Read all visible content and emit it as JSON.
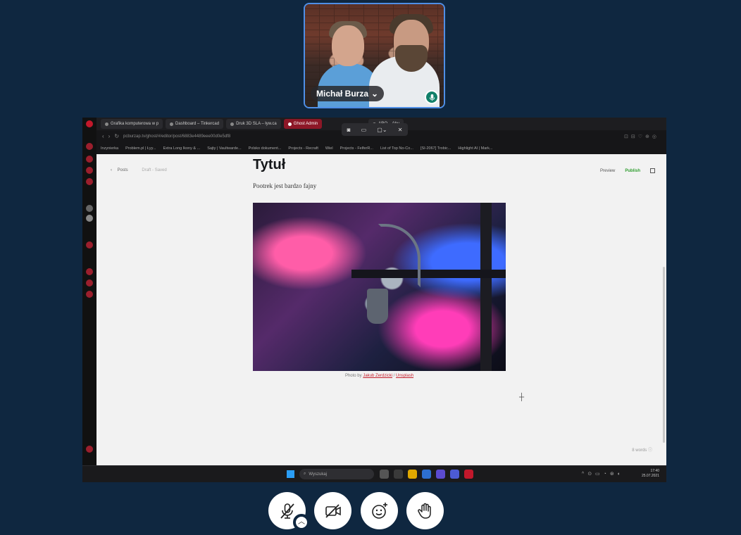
{
  "participant": {
    "name": "Michał Burza",
    "speaking": true
  },
  "browser": {
    "tabs": [
      {
        "label": "Grafika komputerowa w p",
        "active": false
      },
      {
        "label": "Dashboard – Tinkercad",
        "active": false
      },
      {
        "label": "Druk 3D SLA – ływ.ca",
        "active": false
      },
      {
        "label": "Ghost Admin",
        "active": true
      },
      {
        "label": "ARO – Ahu",
        "active": false
      }
    ],
    "url": "pcburzap.tv/ghost/#/editor/post/6883e4489eee00d0e5df8",
    "bookmarks": [
      "Inzynierka",
      "Problem.pl | Łyy...",
      "Extra Long Ikony & ...",
      "Sajty | Vaultwarde...",
      "Polsko dokument...",
      "Projects - Recraft",
      "Wiel",
      "Projects - FelferR...",
      "List of Top No-Co...",
      "[SI-2067] Trobic...",
      "Highlight AI | Mark..."
    ]
  },
  "editor": {
    "back_label": "Posts",
    "status": "Draft - Saved",
    "preview_label": "Preview",
    "publish_label": "Publish",
    "title": "Tytuł",
    "body": "Pootrek jest bardzo fajny",
    "caption_prefix": "Photo by ",
    "caption_author": "Jakub Zerdzicki",
    "caption_sep": " / ",
    "caption_source": "Unsplash",
    "word_count": "8 words"
  },
  "taskbar": {
    "search_placeholder": "Wyszukaj",
    "time": "17:40",
    "date": "25.07.2021"
  },
  "colors": {
    "background": "#0f2740",
    "tile_border": "#4f8fe6",
    "active_tab": "#8d1727",
    "publish": "#2f9e2f",
    "speaking_badge": "#11806a"
  }
}
